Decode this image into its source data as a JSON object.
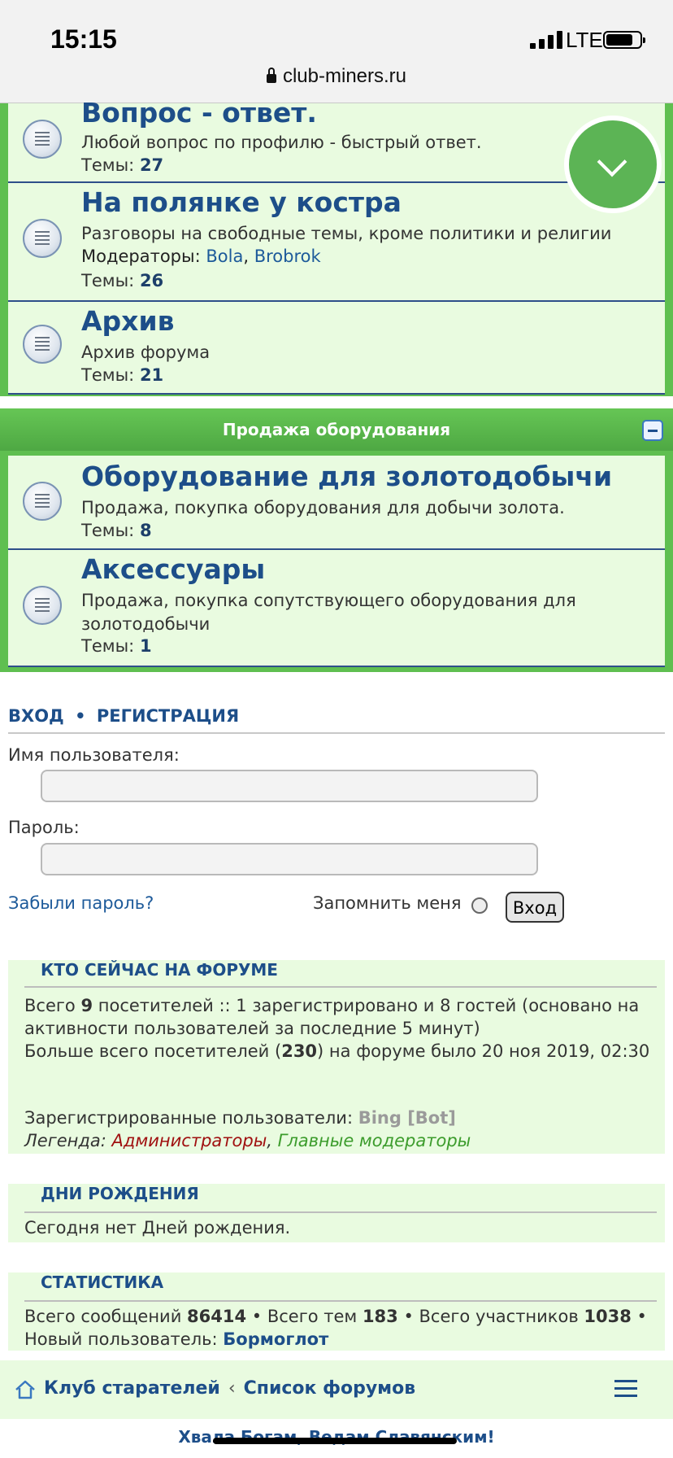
{
  "status": {
    "time": "15:15",
    "network": "LTE",
    "url": "club-miners.ru"
  },
  "forums_top": [
    {
      "title": "Вопрос - ответ.",
      "desc": "Любой вопрос по профилю - быстрый ответ.",
      "topics_label": "Темы:",
      "topics": "27"
    },
    {
      "title": "На полянке у костра",
      "desc": "Разговоры на свободные темы, кроме политики и религии",
      "mods_label": "Модераторы:",
      "mod1": "Bola",
      "mod2": "Brobrok",
      "topics_label": "Темы:",
      "topics": "26"
    },
    {
      "title": "Архив",
      "desc": "Архив форума",
      "topics_label": "Темы:",
      "topics": "21"
    }
  ],
  "category": {
    "title": "Продажа оборудования"
  },
  "forums_sale": [
    {
      "title": "Оборудование для золотодобычи",
      "desc": "Продажа, покупка оборудования для добычи золота.",
      "topics_label": "Темы:",
      "topics": "8"
    },
    {
      "title": "Аксессуары",
      "desc": "Продажа, покупка сопутствующего оборудования для золотодобычи",
      "topics_label": "Темы:",
      "topics": "1"
    }
  ],
  "login": {
    "login_link": "ВХОД",
    "bullet": "•",
    "register_link": "РЕГИСТРАЦИЯ",
    "username_label": "Имя пользователя:",
    "password_label": "Пароль:",
    "username_value": "",
    "password_value": "",
    "forgot": "Забыли пароль?",
    "remember": "Запомнить меня",
    "submit": "Вход"
  },
  "online": {
    "title": "КТО СЕЙЧАС НА ФОРУМЕ",
    "l1a": "Всего ",
    "l1b": "9",
    "l1c": " посетителей :: 1 зарегистрировано и 8 гостей (основано на активности пользователей за последние 5 минут)",
    "l2a": "Больше всего посетителей (",
    "l2b": "230",
    "l2c": ") на форуме было 20 ноя 2019, 02:30",
    "reg_label": "Зарегистрированные пользователи: ",
    "reg_user": "Bing [Bot]",
    "legend_label": "Легенда: ",
    "legend_admin": "Администраторы",
    "legend_sep": ", ",
    "legend_gmod": "Главные модераторы"
  },
  "birthdays": {
    "title": "ДНИ РОЖДЕНИЯ",
    "text": "Сегодня нет Дней рождения."
  },
  "stats": {
    "title": "СТАТИСТИКА",
    "a": "Всего сообщений ",
    "posts": "86414",
    "b": " • Всего тем ",
    "topics": "183",
    "c": " • Всего участников ",
    "members": "1038",
    "d": " • Новый пользователь: ",
    "newest": "Бормоглот"
  },
  "nav": {
    "home": "Клуб старателей",
    "sep": "‹",
    "current": "Список форумов"
  },
  "footer": {
    "text": "Хвала Богам, Ведам Славянским!"
  },
  "colors": {
    "accent": "#5fbf50",
    "link": "#1d4e89",
    "panel": "#e9fbe0"
  }
}
